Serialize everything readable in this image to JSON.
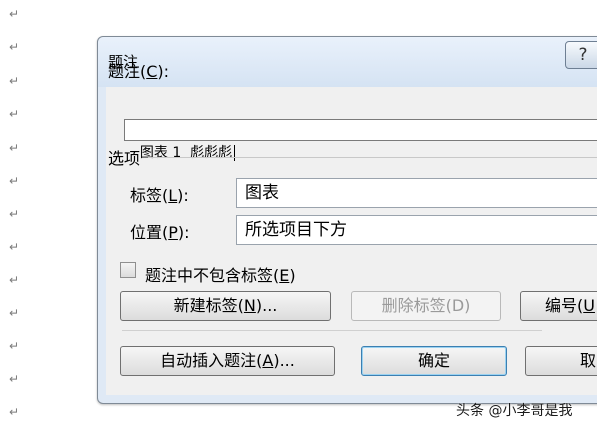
{
  "document": {
    "paragraph_mark": "↵"
  },
  "dialog": {
    "title": "题注",
    "help_glyph": "?",
    "caption": {
      "label": "题注(",
      "hotkey": "C",
      "label_end": "):",
      "value": "图表 1  彪彪彪"
    },
    "options_group": "选项",
    "label_field": {
      "label": "标签(",
      "hotkey": "L",
      "label_end": "):",
      "value": "图表"
    },
    "position_field": {
      "label": "位置(",
      "hotkey": "P",
      "label_end": "):",
      "value": "所选项目下方"
    },
    "exclude_checkbox": {
      "label": "题注中不包含标签(",
      "hotkey": "E",
      "label_end": ")",
      "checked": false
    },
    "buttons": {
      "new_label": {
        "label": "新建标签(",
        "hotkey": "N",
        "label_end": ")..."
      },
      "delete_label": {
        "label": "删除标签(D)"
      },
      "numbering": {
        "label": "编号(",
        "hotkey": "U"
      },
      "auto_caption": {
        "label": "自动插入题注(",
        "hotkey": "A",
        "label_end": ")..."
      },
      "ok": {
        "label": "确定"
      },
      "cancel": {
        "label": "取"
      }
    }
  },
  "watermark": "头条 @小李哥是我"
}
